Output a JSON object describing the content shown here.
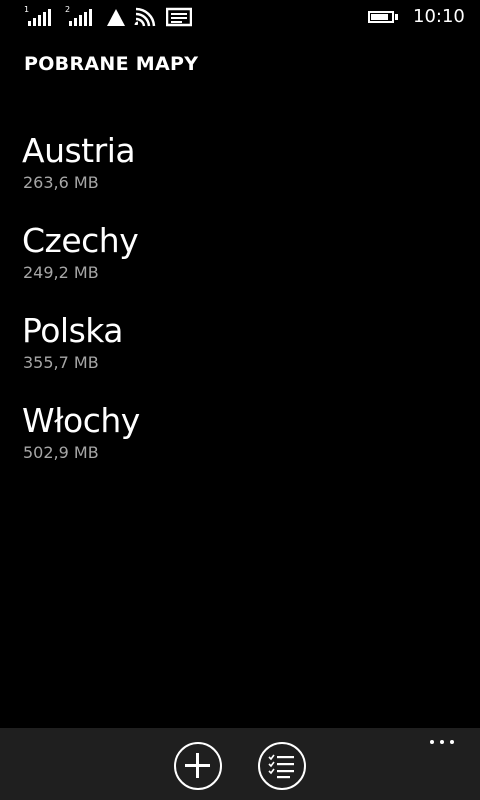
{
  "status_bar": {
    "sim1_label": "1",
    "sim2_label": "2",
    "time": "10:10",
    "battery_level": 0.85
  },
  "header": {
    "title": "POBRANE MAPY"
  },
  "maps": [
    {
      "name": "Austria",
      "size": "263,6 MB"
    },
    {
      "name": "Czechy",
      "size": "249,2 MB"
    },
    {
      "name": "Polska",
      "size": "355,7 MB"
    },
    {
      "name": "Włochy",
      "size": "502,9 MB"
    }
  ],
  "app_bar": {
    "buttons": [
      {
        "icon": "plus-icon"
      },
      {
        "icon": "checklist-icon"
      }
    ],
    "more_icon": "ellipsis-icon"
  },
  "colors": {
    "background": "#000000",
    "text": "#ffffff",
    "secondary_text": "#a6a6a6",
    "app_bar": "#1f1f1f"
  }
}
